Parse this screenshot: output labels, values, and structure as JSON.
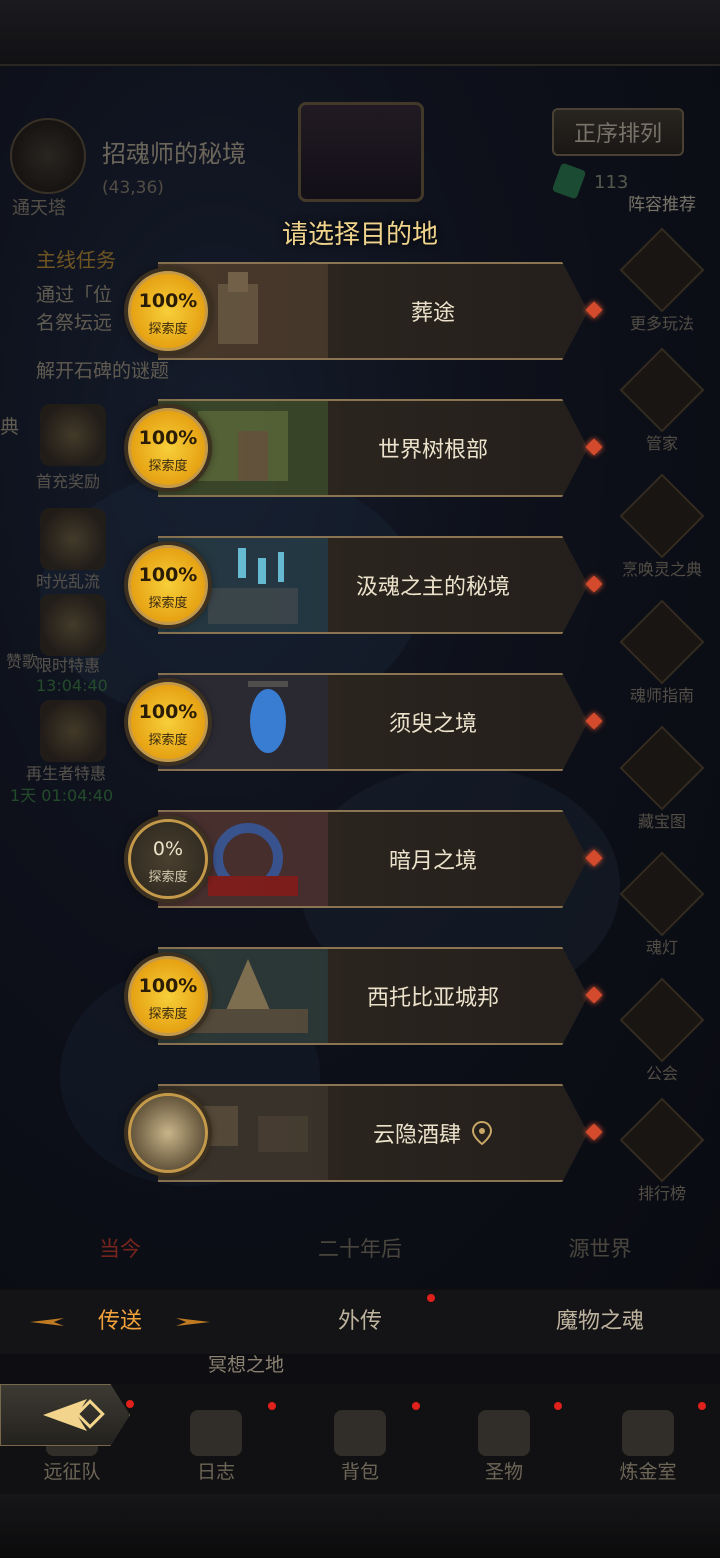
{
  "region": {
    "name": "招魂师的秘境",
    "coords": "(43,36)",
    "sub": "通天塔"
  },
  "header": {
    "sort_label": "正序排列",
    "gem_count": "113",
    "lineup_label": "阵容推荐"
  },
  "quest": {
    "title": "主线任务",
    "line1": "通过「位",
    "line2": "名祭坛远",
    "line3": "解开石碑的谜题",
    "partial_left": "典"
  },
  "left_menu": {
    "first_charge": "首充奖励",
    "time_flow": "时光乱流",
    "sponsor": "赞歌",
    "limited_sale": "限时特惠",
    "limited_timer": "13:04:40",
    "reborn_sale": "再生者特惠",
    "reborn_timer": "1天 01:04:40"
  },
  "right_menu": [
    "更多玩法",
    "管家",
    "烹唤灵之典",
    "魂师指南",
    "藏宝图",
    "魂灯",
    "公会",
    "排行榜"
  ],
  "popup": {
    "title": "请选择目的地",
    "explore_label": "探索度",
    "destinations": [
      {
        "name": "葬途",
        "percent": "100%"
      },
      {
        "name": "世界树根部",
        "percent": "100%"
      },
      {
        "name": "汲魂之主的秘境",
        "percent": "100%"
      },
      {
        "name": "须臾之境",
        "percent": "100%"
      },
      {
        "name": "暗月之境",
        "percent": "0%"
      },
      {
        "name": "西托比亚城邦",
        "percent": "100%"
      },
      {
        "name": "云隐酒肆",
        "percent": ""
      }
    ]
  },
  "eras": [
    "当今",
    "二十年后",
    "源世界"
  ],
  "tabs": [
    "传送",
    "外传",
    "魔物之魂"
  ],
  "under_tabs": {
    "left": "返回冒险",
    "center": "冥想之地"
  },
  "nav": [
    "远征队",
    "日志",
    "背包",
    "圣物",
    "炼金室"
  ],
  "colors": {
    "accent": "#f2a23a",
    "era_active": "#e0412e",
    "gold": "#f7cf3a"
  }
}
